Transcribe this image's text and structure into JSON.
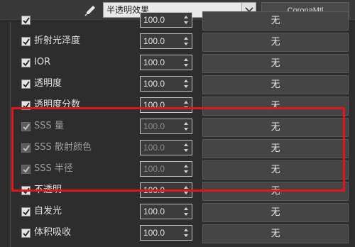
{
  "toolbar": {
    "material_name": "半透明效果",
    "material_type": "CoronaMtl"
  },
  "rows": [
    {
      "label": "",
      "value": "100.0",
      "map": "无",
      "checked": true,
      "dim": false
    },
    {
      "label": "折射光泽度",
      "value": "100.0",
      "map": "无",
      "checked": true,
      "dim": false
    },
    {
      "label": "IOR",
      "value": "100.0",
      "map": "无",
      "checked": true,
      "dim": false
    },
    {
      "label": "透明度",
      "value": "100.0",
      "map": "无",
      "checked": true,
      "dim": false
    },
    {
      "label": "透明度分数",
      "value": "100.0",
      "map": "无",
      "checked": true,
      "dim": false
    },
    {
      "label": "SSS 量",
      "value": "100.0",
      "map": "无",
      "checked": true,
      "dim": true
    },
    {
      "label": "SSS 散射颜色",
      "value": "100.0",
      "map": "无",
      "checked": true,
      "dim": true
    },
    {
      "label": "SSS 半径",
      "value": "100.0",
      "map": "无",
      "checked": true,
      "dim": true
    },
    {
      "label": "不透明",
      "value": "100.0",
      "map": "无",
      "checked": true,
      "dim": false
    },
    {
      "label": "自发光",
      "value": "100.0",
      "map": "无",
      "checked": true,
      "dim": false
    },
    {
      "label": "体积吸收",
      "value": "100.0",
      "map": "无",
      "checked": true,
      "dim": false
    }
  ],
  "colors": {
    "highlight": "#e0181c",
    "panel_bg": "#2d2d2d"
  }
}
